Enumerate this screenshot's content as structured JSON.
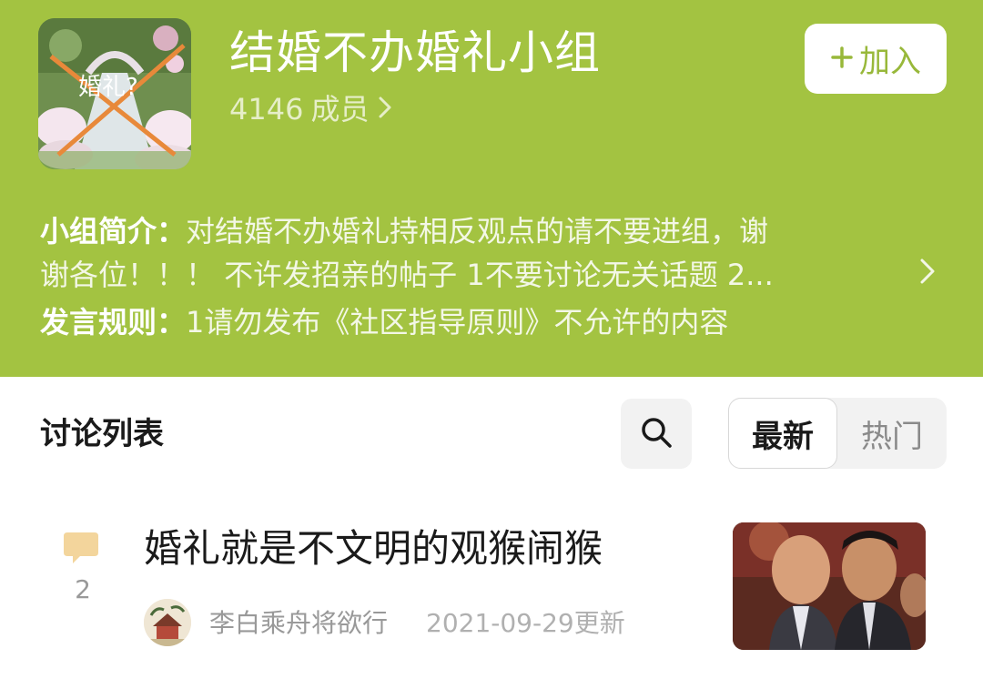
{
  "group": {
    "name": "结婚不办婚礼小组",
    "member_count": "4146",
    "member_unit": "成员",
    "join_label": "加入",
    "avatar_text": "婚礼?"
  },
  "intro": {
    "label": "小组简介：",
    "line1": "对结婚不办婚礼持相反观点的请不要进组，谢",
    "line2": "谢各位！！！ 不许发招亲的帖子 1不要讨论无关话题 2..."
  },
  "rules": {
    "label": "发言规则：",
    "text": "1请勿发布《社区指导原则》不允许的内容"
  },
  "discussion": {
    "section_title": "讨论列表",
    "tabs": [
      {
        "label": "最新",
        "selected": true
      },
      {
        "label": "热门",
        "selected": false
      }
    ]
  },
  "posts": [
    {
      "title": "婚礼就是不文明的观猴闹猴",
      "comment_count": "2",
      "author": "李白乘舟将欲行",
      "date": "2021-09-29更新"
    }
  ],
  "colors": {
    "header_bg": "#a3c341",
    "accent": "#98b83a",
    "comment_icon": "#f3d59c"
  },
  "icons": [
    "search-icon",
    "chevron-right-icon",
    "plus-icon",
    "comment-icon"
  ]
}
